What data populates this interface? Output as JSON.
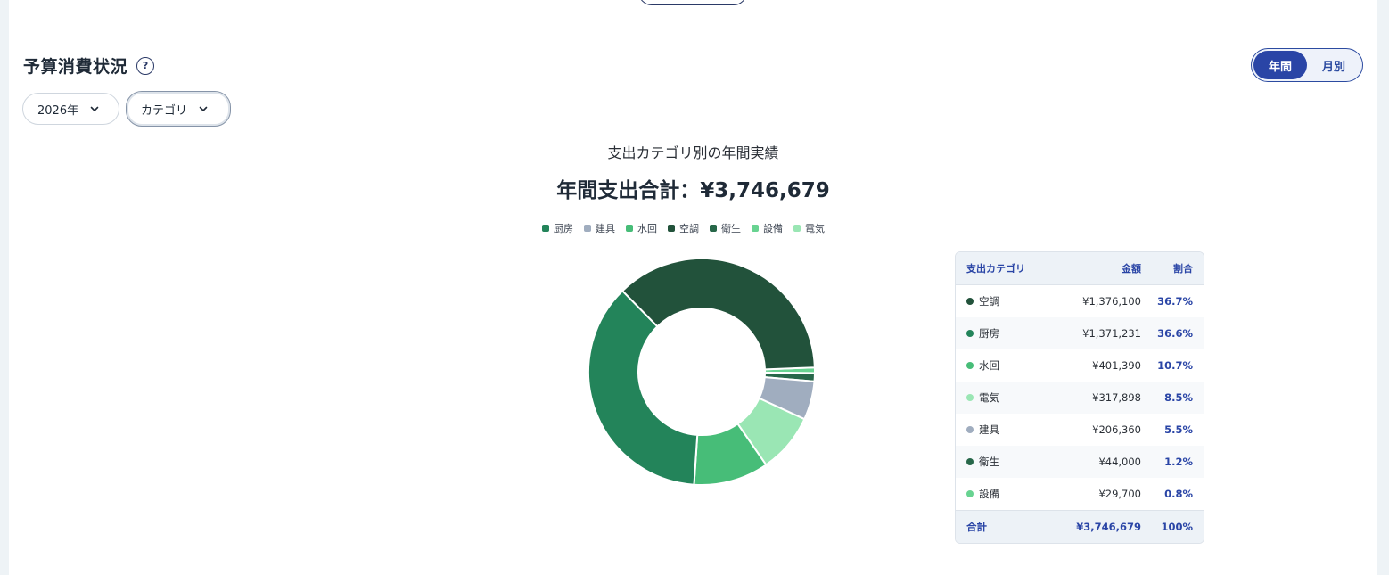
{
  "section": {
    "title": "予算消費状況",
    "help_icon": "?"
  },
  "period_toggle": {
    "options": [
      "年間",
      "月別"
    ],
    "selected": "年間"
  },
  "filters": {
    "year": "2026年",
    "grouping": "カテゴリ"
  },
  "chart_data": {
    "type": "pie",
    "title": "支出カテゴリ別の年間実績",
    "subtitle": "年間支出合計：¥3,746,679",
    "legend_order": [
      "厨房",
      "建具",
      "水回",
      "空調",
      "衛生",
      "設備",
      "電気"
    ],
    "legend_position": "top",
    "categories": [
      "空調",
      "厨房",
      "水回",
      "電気",
      "建具",
      "衛生",
      "設備"
    ],
    "values": [
      1376100,
      1371231,
      401390,
      317898,
      206360,
      44000,
      29700
    ],
    "colors": {
      "空調": "#22523b",
      "厨房": "#23845a",
      "水回": "#47bd78",
      "電気": "#9ae6b4",
      "建具": "#a0adbf",
      "衛生": "#276749",
      "設備": "#68d391"
    }
  },
  "table": {
    "headers": [
      "支出カテゴリ",
      "金額",
      "割合"
    ],
    "rows": [
      {
        "name": "空調",
        "amount": "¥1,376,100",
        "pct": "36.7%"
      },
      {
        "name": "厨房",
        "amount": "¥1,371,231",
        "pct": "36.6%"
      },
      {
        "name": "水回",
        "amount": "¥401,390",
        "pct": "10.7%"
      },
      {
        "name": "電気",
        "amount": "¥317,898",
        "pct": "8.5%"
      },
      {
        "name": "建具",
        "amount": "¥206,360",
        "pct": "5.5%"
      },
      {
        "name": "衛生",
        "amount": "¥44,000",
        "pct": "1.2%"
      },
      {
        "name": "設備",
        "amount": "¥29,700",
        "pct": "0.8%"
      }
    ],
    "footer": {
      "name": "合計",
      "amount": "¥3,746,679",
      "pct": "100%"
    }
  }
}
